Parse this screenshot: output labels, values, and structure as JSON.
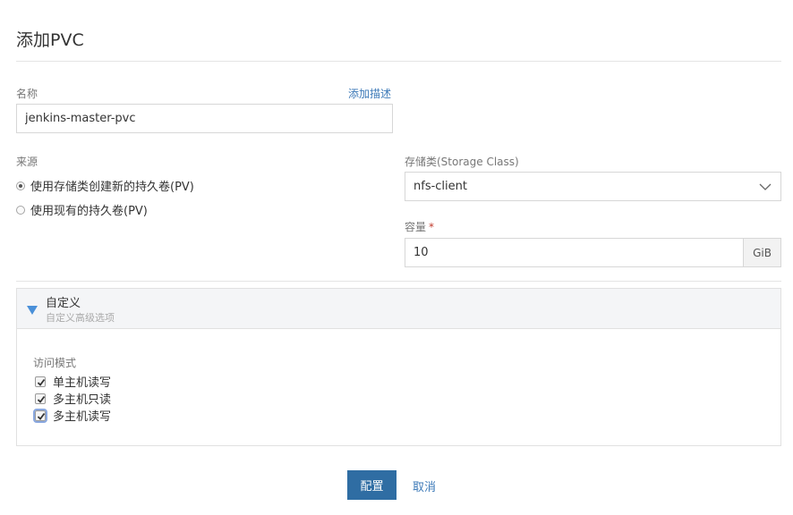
{
  "header": {
    "title": "添加PVC"
  },
  "name_field": {
    "label": "名称",
    "add_description": "添加描述",
    "value": "jenkins-master-pvc"
  },
  "source": {
    "label": "来源",
    "options": [
      {
        "label": "使用存储类创建新的持久卷(PV)",
        "checked": true
      },
      {
        "label": "使用现有的持久卷(PV)",
        "checked": false
      }
    ]
  },
  "storage_class": {
    "label": "存储类(Storage Class)",
    "selected": "nfs-client"
  },
  "capacity": {
    "label": "容量",
    "required_mark": "*",
    "value": "10",
    "unit": "GiB"
  },
  "custom": {
    "title": "自定义",
    "subtitle": "自定义高级选项",
    "access_mode": {
      "label": "访问模式",
      "options": [
        {
          "label": "单主机读写",
          "checked": true
        },
        {
          "label": "多主机只读",
          "checked": true
        },
        {
          "label": "多主机读写",
          "checked": true
        }
      ]
    }
  },
  "actions": {
    "submit": "配置",
    "cancel": "取消"
  },
  "colors": {
    "primary": "#2f6da3",
    "link": "#3d7ab8",
    "accent_triangle": "#4a90d9"
  }
}
